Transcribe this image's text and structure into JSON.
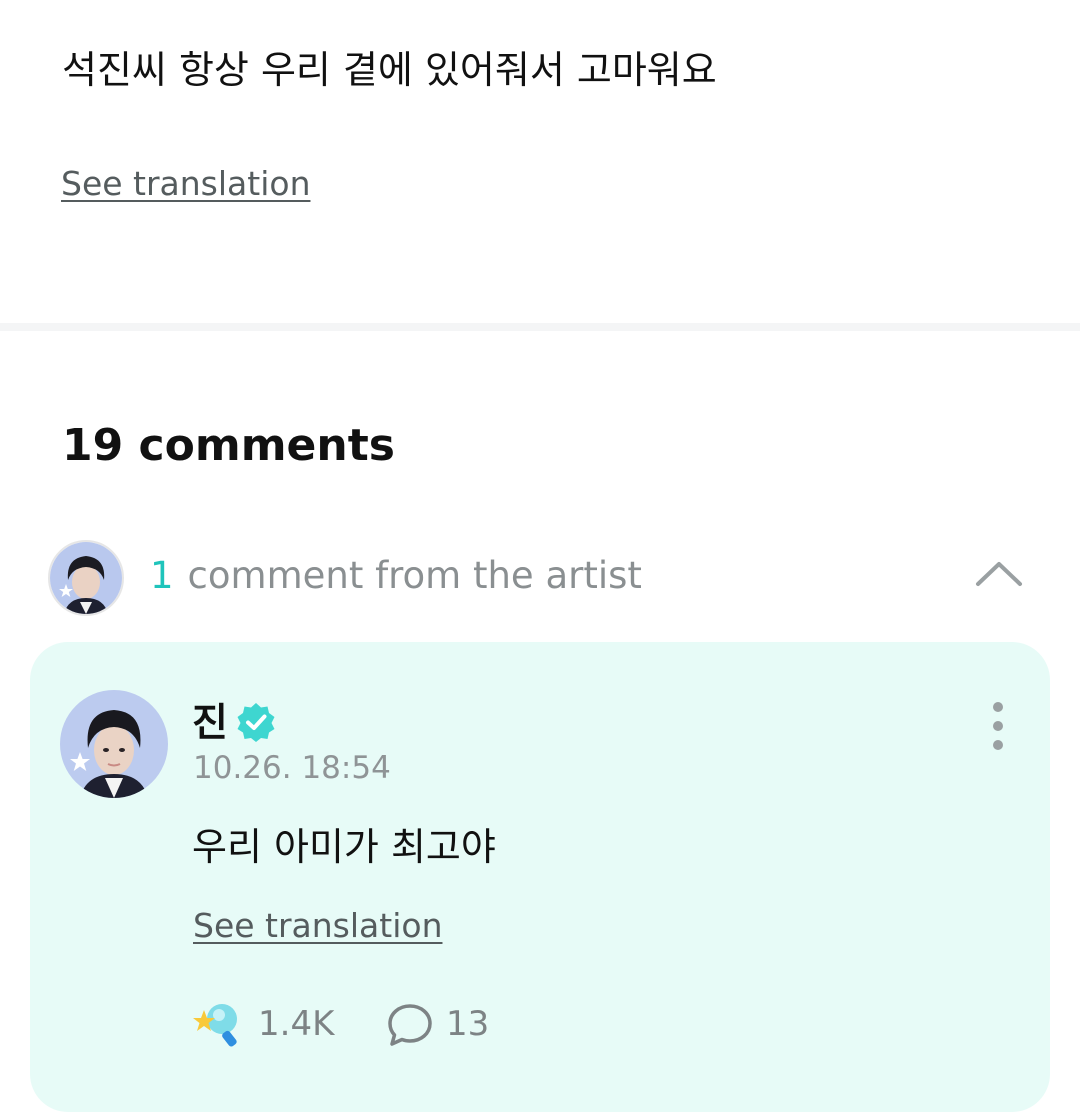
{
  "post": {
    "text": "석진씨 항상 우리 곁에 있어줘서 고마워요",
    "see_translation": "See translation"
  },
  "comments": {
    "title": "19 comments",
    "artist_section": {
      "count": "1",
      "label": "comment from the artist"
    }
  },
  "artist_comment": {
    "author": "진",
    "timestamp": "10.26. 18:54",
    "text": "우리 아미가 최고야",
    "see_translation": "See translation",
    "likes": "1.4K",
    "replies": "13"
  },
  "colors": {
    "accent": "#1fc4bb",
    "card_background": "#e7fbf7",
    "verified_badge": "#3ed6d0"
  }
}
